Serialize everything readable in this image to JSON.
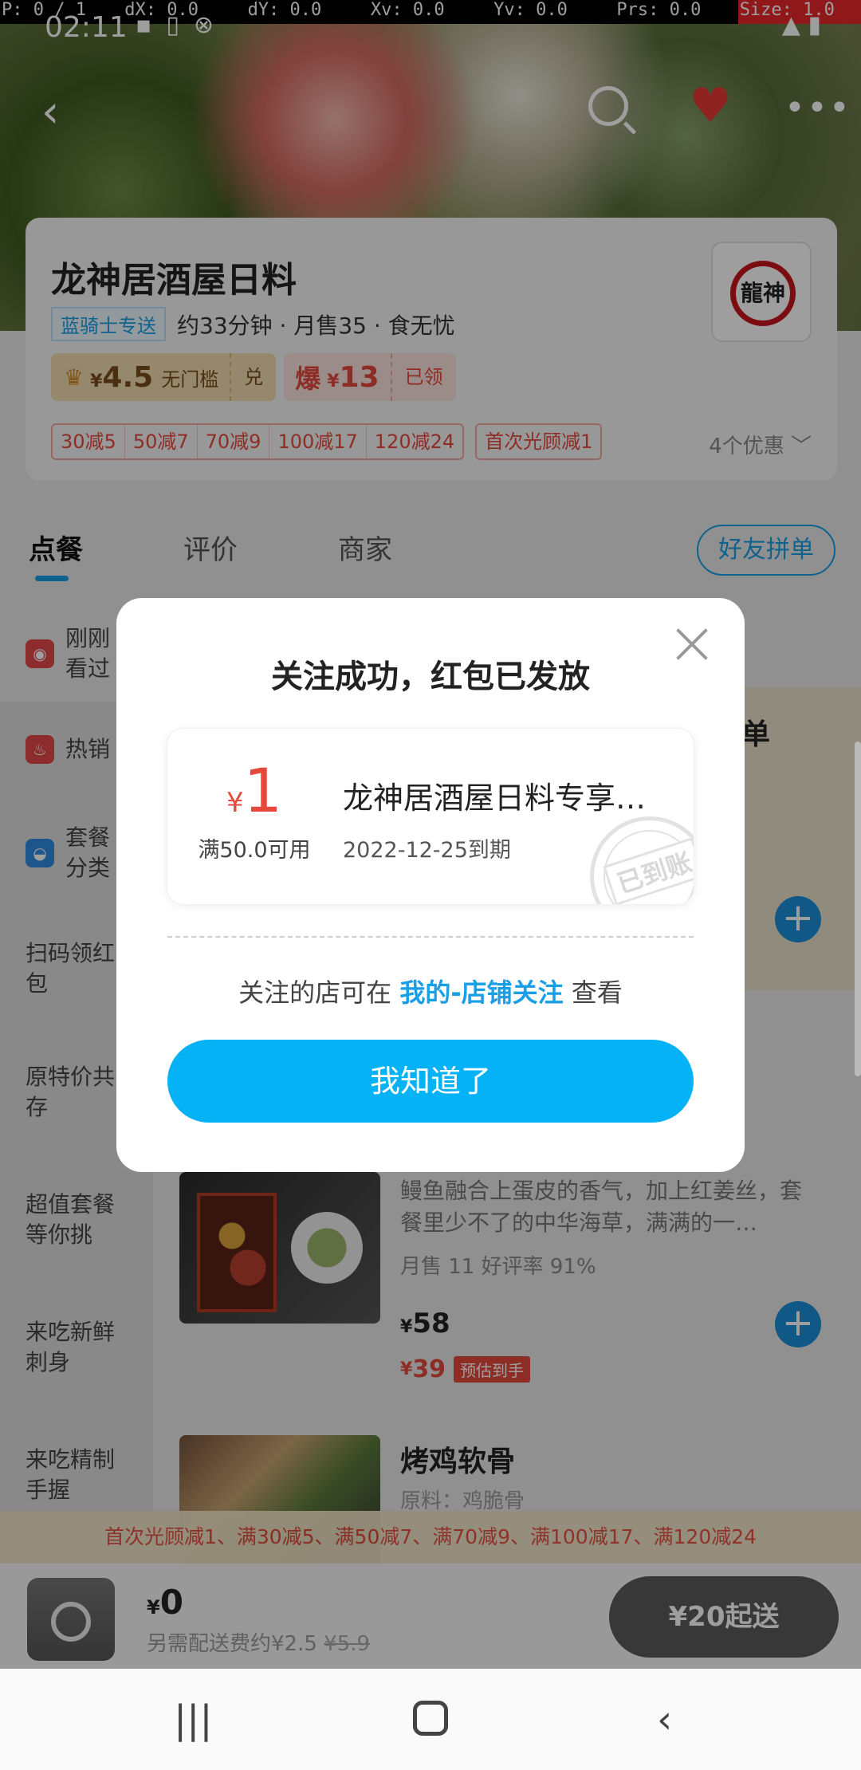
{
  "debug": {
    "p": "P: 0 / 1",
    "dx": "dX: 0.0",
    "dy": "dY: 0.0",
    "xv": "Xv: 0.0",
    "yv": "Yv: 0.0",
    "prs": "Prs: 0.0",
    "size": "Size: 1.0"
  },
  "status": {
    "time": "02:11"
  },
  "store": {
    "name": "龙神居酒屋日料",
    "logo_text": "龍神",
    "rider_tag": "蓝骑士专送",
    "info": "约33分钟 · 月售35 · 食无忧",
    "gold_coupon": {
      "currency": "¥",
      "amount": "4.5",
      "condition": "无门槛",
      "action": "兑"
    },
    "red_coupon": {
      "label": "爆",
      "currency": "¥",
      "amount": "13",
      "status": "已领"
    },
    "discounts": [
      "30减5",
      "50减7",
      "70减9",
      "100减17",
      "120减24"
    ],
    "first_visit": "首次光顾减1",
    "more_offers": "4个优惠 ﹀"
  },
  "tabs": {
    "order": "点餐",
    "reviews": "评价",
    "merchant": "商家",
    "group_order": "好友拼单"
  },
  "sidebar": {
    "recent": "刚刚看过",
    "hot": "热销",
    "combo": "套餐分类",
    "scan": "扫码领红包",
    "coexist": "原特价共存",
    "value_combo": "超值套餐等你挑",
    "sashimi": "来吃新鲜刺身",
    "refined": "来吃精制手握"
  },
  "menu": {
    "promo_title": "订单",
    "dish1": {
      "desc": "鳗鱼融合上蛋皮的香气，加上红姜丝，套餐里少不了的中华海草，满满的一…",
      "stats": "月售 11   好评率 91%",
      "currency": "¥",
      "price": "58",
      "new_price": "39",
      "tag": "预估到手"
    },
    "dish2": {
      "name": "烤鸡软骨",
      "sub": "原料：鸡脆骨"
    }
  },
  "promo_strip": "首次光顾减1、满30减5、满50减7、满70减9、满100减17、满120减24",
  "cart": {
    "currency": "¥",
    "amount": "0",
    "fee_label": "另需配送费约¥2.5",
    "fee_original": "¥5.9",
    "min_order": "¥20起送"
  },
  "dialog": {
    "title": "关注成功，红包已发放",
    "coupon": {
      "currency": "¥",
      "amount": "1",
      "condition": "满50.0可用",
      "name": "龙神居酒屋日料专享红包",
      "expire": "2022-12-25到期",
      "stamp": "已到账"
    },
    "hint_prefix": "关注的店可在 ",
    "hint_link": "我的-店铺关注",
    "hint_suffix": " 查看",
    "button": "我知道了"
  },
  "colors": {
    "accent": "#04b2f5",
    "price_red": "#e6493c",
    "link_blue": "#1a9ee6"
  }
}
